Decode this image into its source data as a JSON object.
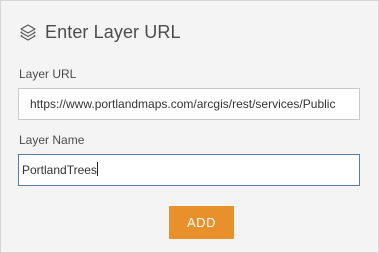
{
  "header": {
    "title": "Enter Layer URL",
    "icon": "layers-icon"
  },
  "form": {
    "url_label": "Layer URL",
    "url_value": "https://www.portlandmaps.com/arcgis/rest/services/Public",
    "name_label": "Layer Name",
    "name_value": "PortlandTrees"
  },
  "actions": {
    "add_label": "ADD"
  },
  "colors": {
    "panel_background": "#f4f4f4",
    "add_button": "#e8912b",
    "focused_border": "#5a7aa8"
  }
}
